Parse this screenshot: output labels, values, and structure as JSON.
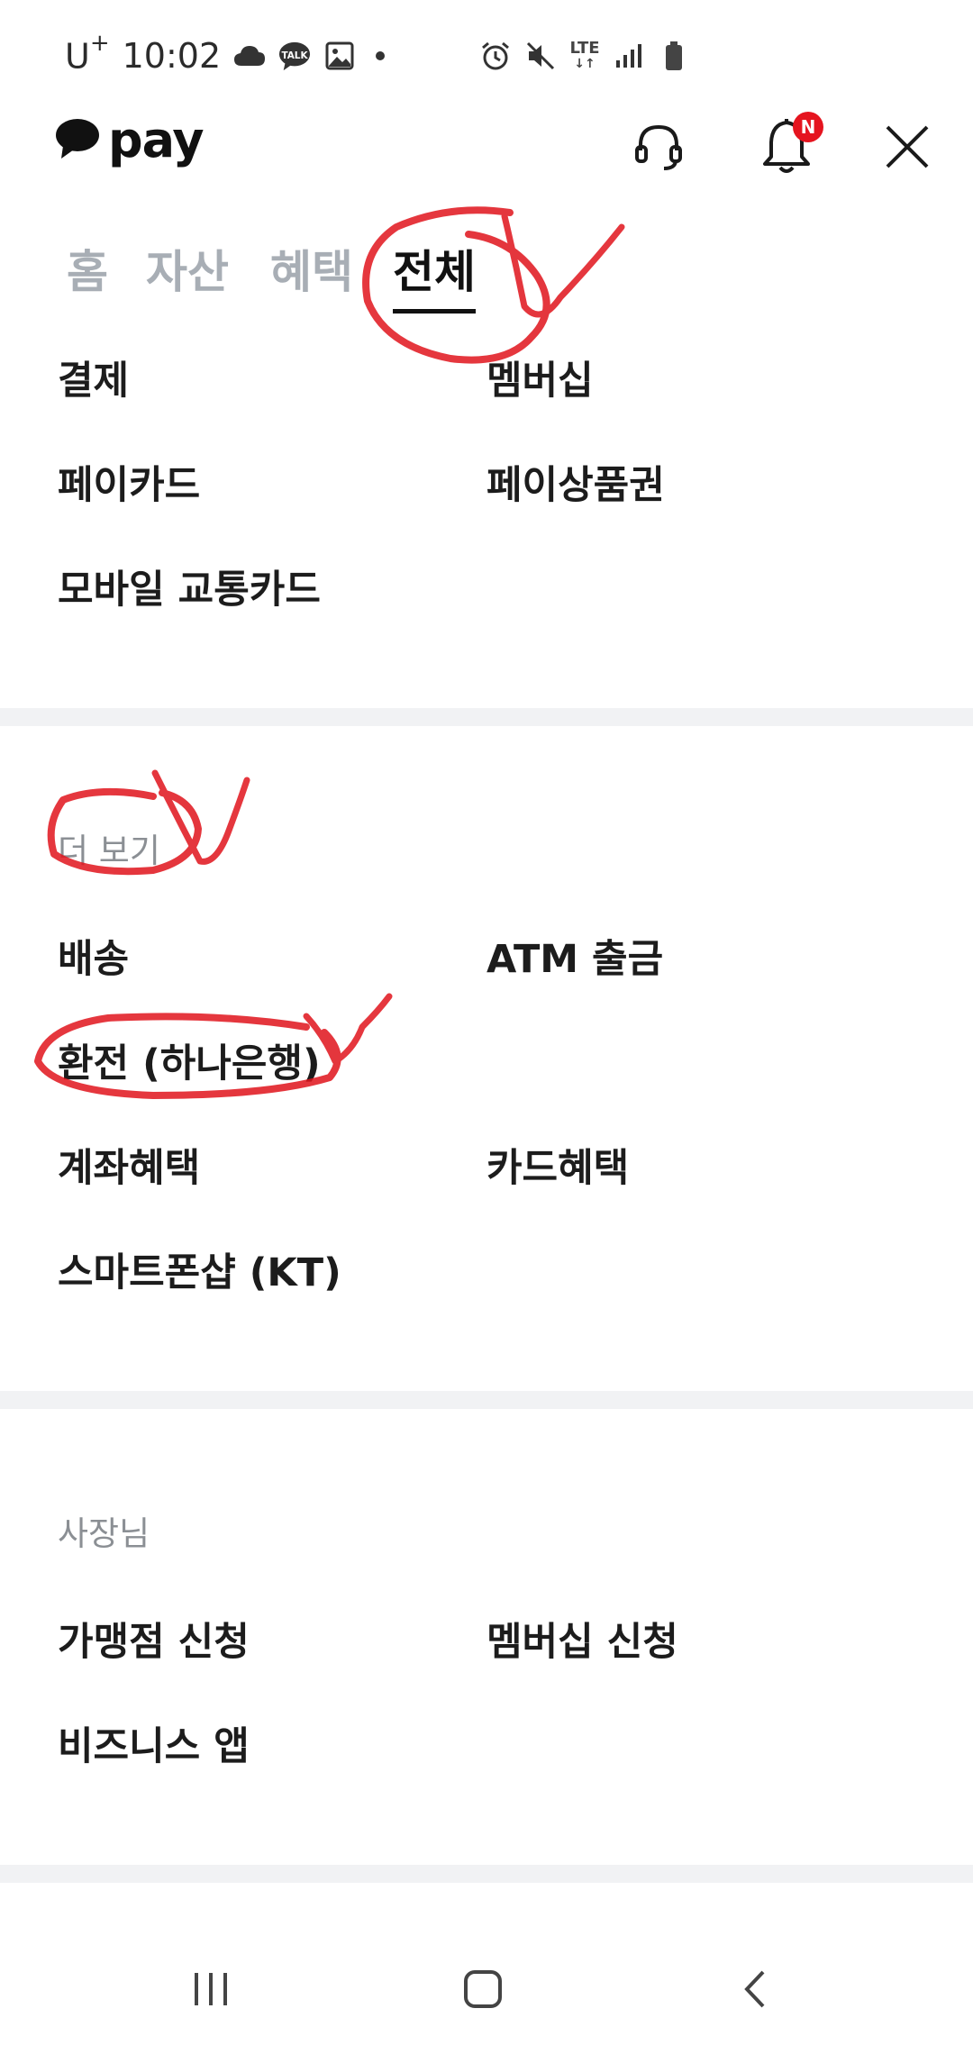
{
  "status_bar": {
    "carrier": "U",
    "carrier_plus": "+",
    "time": "10:02",
    "network": "LTE"
  },
  "header": {
    "logo_text": "pay",
    "notification_badge": "N"
  },
  "tabs": [
    {
      "label": "홈",
      "active": false
    },
    {
      "label": "자산",
      "active": false
    },
    {
      "label": "혜택",
      "active": false
    },
    {
      "label": "전체",
      "active": true
    }
  ],
  "section1": {
    "items": [
      "결제",
      "멤버십",
      "페이카드",
      "페이상품권",
      "모바일 교통카드"
    ]
  },
  "section2": {
    "label": "더 보기",
    "items": [
      "배송",
      "ATM 출금",
      "환전 (하나은행)",
      "계좌혜택",
      "카드혜택",
      "스마트폰샵 (KT)"
    ]
  },
  "section3": {
    "label": "사장님",
    "items": [
      "가맹점 신청",
      "멤버십 신청",
      "비즈니스 앱"
    ]
  },
  "colors": {
    "badge": "#e5141f",
    "annotation": "#e0141c",
    "inactive_tab": "#a8aeb5",
    "divider": "#f1f2f4"
  },
  "icons": [
    "cloud-icon",
    "talk-icon",
    "gallery-icon",
    "alarm-icon",
    "mute-icon",
    "signal-icon",
    "battery-icon",
    "speech-bubble-icon",
    "headset-icon",
    "bell-icon",
    "close-icon",
    "recents-icon",
    "home-icon",
    "back-icon"
  ]
}
